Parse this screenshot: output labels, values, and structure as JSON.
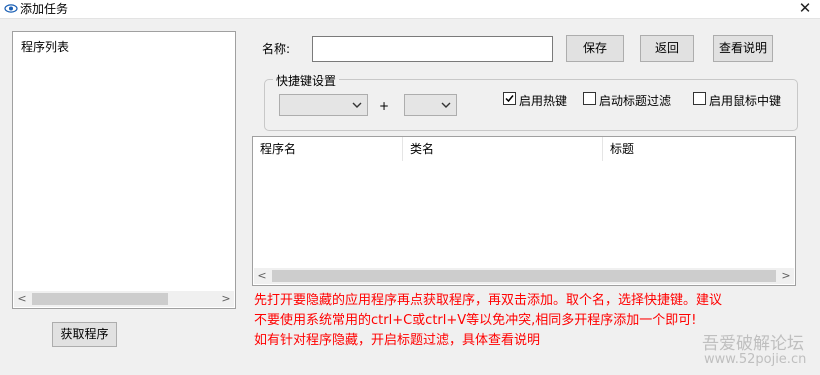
{
  "window": {
    "title": "添加任务",
    "close_glyph": "✕"
  },
  "program_list": {
    "label": "程序列表",
    "scroll_left": "<",
    "scroll_right": ">"
  },
  "get_programs_button": "获取程序",
  "name_field": {
    "label": "名称:",
    "value": ""
  },
  "buttons": {
    "save": "保存",
    "back": "返回",
    "help": "查看说明"
  },
  "hotkey_group": {
    "title": "快捷键设置",
    "modifier_value": "",
    "plus": "+",
    "key_value": "",
    "options": [
      {
        "label": "启用热键",
        "checked": true
      },
      {
        "label": "启动标题过滤",
        "checked": false
      },
      {
        "label": "启用鼠标中键",
        "checked": false
      }
    ]
  },
  "table": {
    "columns": [
      "程序名",
      "类名",
      "标题"
    ],
    "rows": [],
    "scroll_left": "<",
    "scroll_right": ">"
  },
  "notes": [
    "先打开要隐藏的应用程序再点获取程序，再双击添加。取个名，选择快捷键。建议",
    "不要使用系统常用的ctrl+C或ctrl+V等以免冲突,相同多开程序添加一个即可!",
    "如有针对程序隐藏，开启标题过滤，具体查看说明"
  ],
  "watermark": {
    "line1": "吾爱破解论坛",
    "line2": "www.52pojie.cn"
  },
  "colors": {
    "note": "#ff0000",
    "window_bg": "#f0f0f0"
  }
}
